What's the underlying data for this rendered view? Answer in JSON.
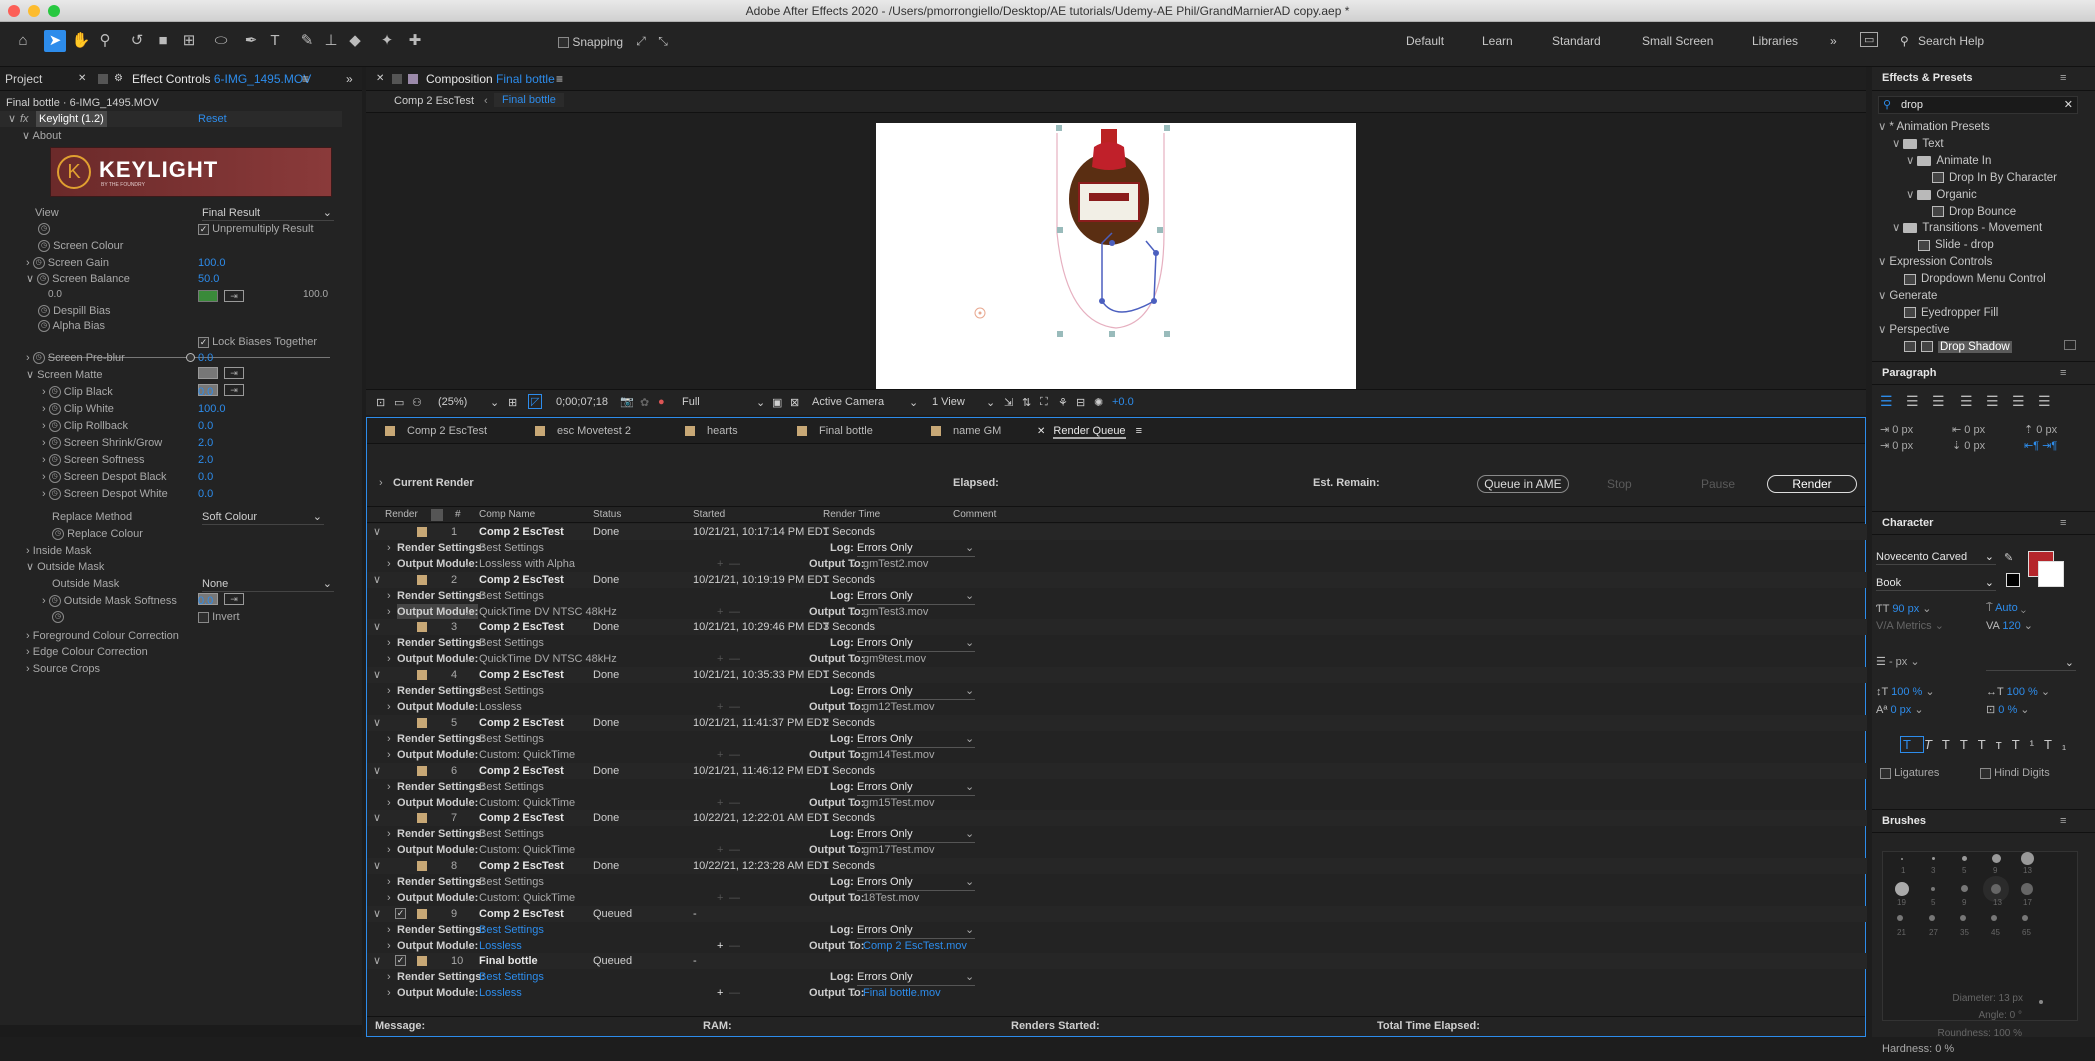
{
  "window_title": "Adobe After Effects 2020 - /Users/pmorrongiello/Desktop/AE tutorials/Udemy-AE Phil/GrandMarnierAD copy.aep *",
  "toolbar": {
    "snapping": "Snapping",
    "workspaces": [
      "Default",
      "Learn",
      "Standard",
      "Small Screen",
      "Libraries"
    ],
    "search_help": "Search Help"
  },
  "left": {
    "tab_project": "Project",
    "tab_effect_prefix": "Effect Controls",
    "tab_effect_file": "6-IMG_1495.MOV",
    "layer_path": "Final bottle · 6-IMG_1495.MOV",
    "fx_label": "fx",
    "effect_name": "Keylight (1.2)",
    "reset": "Reset",
    "about": "About",
    "logo_text": "KEYLIGHT",
    "logo_sub": "BY THE FOUNDRY",
    "view_label": "View",
    "view_value": "Final Result",
    "unpremultiply": "Unpremultiply Result",
    "screen_colour": "Screen Colour",
    "screen_colour_hex": "#3a8a3a",
    "screen_gain": "Screen Gain",
    "screen_gain_val": "100.0",
    "screen_balance": "Screen Balance",
    "screen_balance_val": "50.0",
    "slider_min": "0.0",
    "slider_max": "100.0",
    "despill_bias": "Despill Bias",
    "alpha_bias": "Alpha Bias",
    "lock_biases": "Lock Biases Together",
    "screen_preblur": "Screen Pre-blur",
    "screen_preblur_val": "0.0",
    "screen_matte": "Screen Matte",
    "matte_items": [
      {
        "label": "Clip Black",
        "value": "0.0"
      },
      {
        "label": "Clip White",
        "value": "100.0"
      },
      {
        "label": "Clip Rollback",
        "value": "0.0"
      },
      {
        "label": "Screen Shrink/Grow",
        "value": "2.0"
      },
      {
        "label": "Screen Softness",
        "value": "2.0"
      },
      {
        "label": "Screen Despot Black",
        "value": "0.0"
      },
      {
        "label": "Screen Despot White",
        "value": "0.0"
      }
    ],
    "replace_method": "Replace Method",
    "replace_method_val": "Soft Colour",
    "replace_colour": "Replace Colour",
    "inside_mask": "Inside Mask",
    "outside_mask": "Outside Mask",
    "outside_mask_sub": "Outside Mask",
    "outside_mask_val": "None",
    "outside_mask_softness": "Outside Mask Softness",
    "outside_mask_softness_val": "0.0",
    "invert": "Invert",
    "foreground_cc": "Foreground Colour Correction",
    "edge_cc": "Edge Colour Correction",
    "source_crops": "Source Crops"
  },
  "comp": {
    "tab_prefix": "Composition",
    "tab_name": "Final bottle",
    "crumb1": "Comp 2 EscTest",
    "crumb2": "Final bottle",
    "zoom": "(25%)",
    "timecode": "0;00;07;18",
    "resolution": "Full",
    "camera": "Active Camera",
    "view": "1 View",
    "exposure": "+0.0"
  },
  "timeline_tabs": [
    "Comp 2 EscTest",
    "esc Movetest 2",
    "hearts",
    "Final bottle",
    "name GM",
    "Render Queue"
  ],
  "rq": {
    "current_render": "Current Render",
    "elapsed": "Elapsed:",
    "est_remain": "Est. Remain:",
    "queue_ame": "Queue in AME",
    "stop": "Stop",
    "pause": "Pause",
    "render": "Render",
    "cols": {
      "render": "Render",
      "num": "#",
      "comp": "Comp Name",
      "status": "Status",
      "started": "Started",
      "time": "Render Time",
      "comment": "Comment"
    },
    "render_settings_label": "Render Settings:",
    "output_module_label": "Output Module:",
    "log_label": "Log:",
    "output_to_label": "Output To:",
    "items": [
      {
        "num": "1",
        "comp": "Comp 2 EscTest",
        "status": "Done",
        "started": "10/21/21, 10:17:14 PM EDT",
        "time": "1 Seconds",
        "rs": "Best Settings",
        "log": "Errors Only",
        "om": "Lossless with Alpha",
        "out": "gmTest2.mov",
        "queued": false
      },
      {
        "num": "2",
        "comp": "Comp 2 EscTest",
        "status": "Done",
        "started": "10/21/21, 10:19:19 PM EDT",
        "time": "1 Seconds",
        "rs": "Best Settings",
        "log": "Errors Only",
        "om": "QuickTime DV NTSC 48kHz",
        "out": "gmTest3.mov",
        "queued": false
      },
      {
        "num": "3",
        "comp": "Comp 2 EscTest",
        "status": "Done",
        "started": "10/21/21, 10:29:46 PM EDT",
        "time": "3 Seconds",
        "rs": "Best Settings",
        "log": "Errors Only",
        "om": "QuickTime DV NTSC 48kHz",
        "out": "gm9test.mov",
        "queued": false
      },
      {
        "num": "4",
        "comp": "Comp 2 EscTest",
        "status": "Done",
        "started": "10/21/21, 10:35:33 PM EDT",
        "time": "1 Seconds",
        "rs": "Best Settings",
        "log": "Errors Only",
        "om": "Lossless",
        "out": "gm12Test.mov",
        "queued": false
      },
      {
        "num": "5",
        "comp": "Comp 2 EscTest",
        "status": "Done",
        "started": "10/21/21, 11:41:37 PM EDT",
        "time": "2 Seconds",
        "rs": "Best Settings",
        "log": "Errors Only",
        "om": "Custom: QuickTime",
        "out": "gm14Test.mov",
        "queued": false
      },
      {
        "num": "6",
        "comp": "Comp 2 EscTest",
        "status": "Done",
        "started": "10/21/21, 11:46:12 PM EDT",
        "time": "1 Seconds",
        "rs": "Best Settings",
        "log": "Errors Only",
        "om": "Custom: QuickTime",
        "out": "gm15Test.mov",
        "queued": false
      },
      {
        "num": "7",
        "comp": "Comp 2 EscTest",
        "status": "Done",
        "started": "10/22/21, 12:22:01 AM EDT",
        "time": "1 Seconds",
        "rs": "Best Settings",
        "log": "Errors Only",
        "om": "Custom: QuickTime",
        "out": "gm17Test.mov",
        "queued": false
      },
      {
        "num": "8",
        "comp": "Comp 2 EscTest",
        "status": "Done",
        "started": "10/22/21, 12:23:28 AM EDT",
        "time": "1 Seconds",
        "rs": "Best Settings",
        "log": "Errors Only",
        "om": "Custom: QuickTime",
        "out": "18Test.mov",
        "queued": false
      },
      {
        "num": "9",
        "comp": "Comp 2 EscTest",
        "status": "Queued",
        "started": "-",
        "time": "",
        "rs": "Best Settings",
        "log": "Errors Only",
        "om": "Lossless",
        "out": "Comp 2 EscTest.mov",
        "queued": true
      },
      {
        "num": "10",
        "comp": "Final bottle",
        "status": "Queued",
        "started": "-",
        "time": "",
        "rs": "Best Settings",
        "log": "Errors Only",
        "om": "Lossless",
        "out": "Final bottle.mov",
        "queued": true
      }
    ],
    "footer": {
      "message": "Message:",
      "ram": "RAM:",
      "renders_started": "Renders Started:",
      "total_time": "Total Time Elapsed:"
    }
  },
  "effects": {
    "title": "Effects & Presets",
    "search": "drop",
    "items": [
      {
        "label": "* Animation Presets",
        "indent": 0,
        "kind": "twirl"
      },
      {
        "label": "Text",
        "indent": 1,
        "kind": "folder"
      },
      {
        "label": "Animate In",
        "indent": 2,
        "kind": "folder"
      },
      {
        "label": "Drop In By Character",
        "indent": 3,
        "kind": "preset"
      },
      {
        "label": "Organic",
        "indent": 2,
        "kind": "folder"
      },
      {
        "label": "Drop Bounce",
        "indent": 3,
        "kind": "preset"
      },
      {
        "label": "Transitions - Movement",
        "indent": 1,
        "kind": "folder"
      },
      {
        "label": "Slide - drop",
        "indent": 2,
        "kind": "preset"
      },
      {
        "label": "Expression Controls",
        "indent": 0,
        "kind": "twirl"
      },
      {
        "label": "Dropdown Menu Control",
        "indent": 1,
        "kind": "preset"
      },
      {
        "label": "Generate",
        "indent": 0,
        "kind": "twirl"
      },
      {
        "label": "Eyedropper Fill",
        "indent": 1,
        "kind": "preset"
      },
      {
        "label": "Perspective",
        "indent": 0,
        "kind": "twirl"
      },
      {
        "label": "Drop Shadow",
        "indent": 1,
        "kind": "preset-selected"
      }
    ]
  },
  "paragraph": {
    "title": "Paragraph",
    "vals": [
      "0 px",
      "0 px",
      "0 px",
      "0 px",
      "0 px"
    ]
  },
  "character": {
    "title": "Character",
    "font": "Novecento Carved",
    "style": "Book",
    "size": "90 px",
    "leading": "Auto",
    "kerning": "Metrics",
    "tracking": "120",
    "stroke": "- px",
    "vscale": "100 %",
    "hscale": "100 %",
    "baseline": "0 px",
    "tsume": "0 %",
    "fill_color": "#b5262b",
    "ligatures": "Ligatures",
    "hindi": "Hindi Digits"
  },
  "brushes": {
    "title": "Brushes",
    "nums_row1": [
      "1",
      "3",
      "5",
      "9",
      "13"
    ],
    "nums_row2": [
      "19",
      "5",
      "9",
      "13",
      "17"
    ],
    "nums_row3": [
      "21",
      "27",
      "35",
      "45",
      "65"
    ],
    "diameter": "Diameter: 13 px",
    "angle": "Angle: 0 °",
    "roundness": "Roundness: 100 %",
    "hardness": "Hardness: 0 %"
  }
}
